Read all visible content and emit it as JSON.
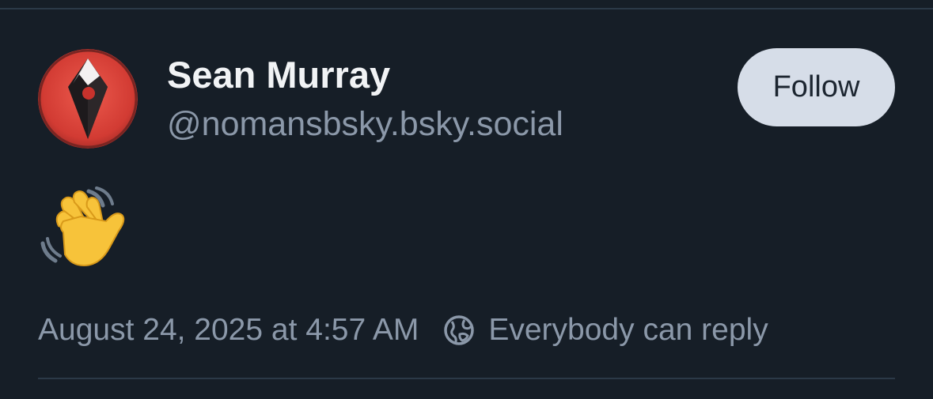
{
  "author": {
    "display_name": "Sean Murray",
    "handle": "@nomansbsky.bsky.social",
    "avatar_icon": "no-mans-sky-diamond-logo"
  },
  "follow_button": {
    "label": "Follow"
  },
  "post": {
    "text": "👋",
    "timestamp": "August 24, 2025 at 4:57 AM",
    "reply_setting": "Everybody can reply",
    "reply_icon": "globe-icon"
  },
  "colors": {
    "background": "#161e27",
    "name": "#f1f3f5",
    "secondary_text": "#8b98a9",
    "follow_button_bg": "#d6dde8",
    "avatar_red": "#d9443b"
  }
}
